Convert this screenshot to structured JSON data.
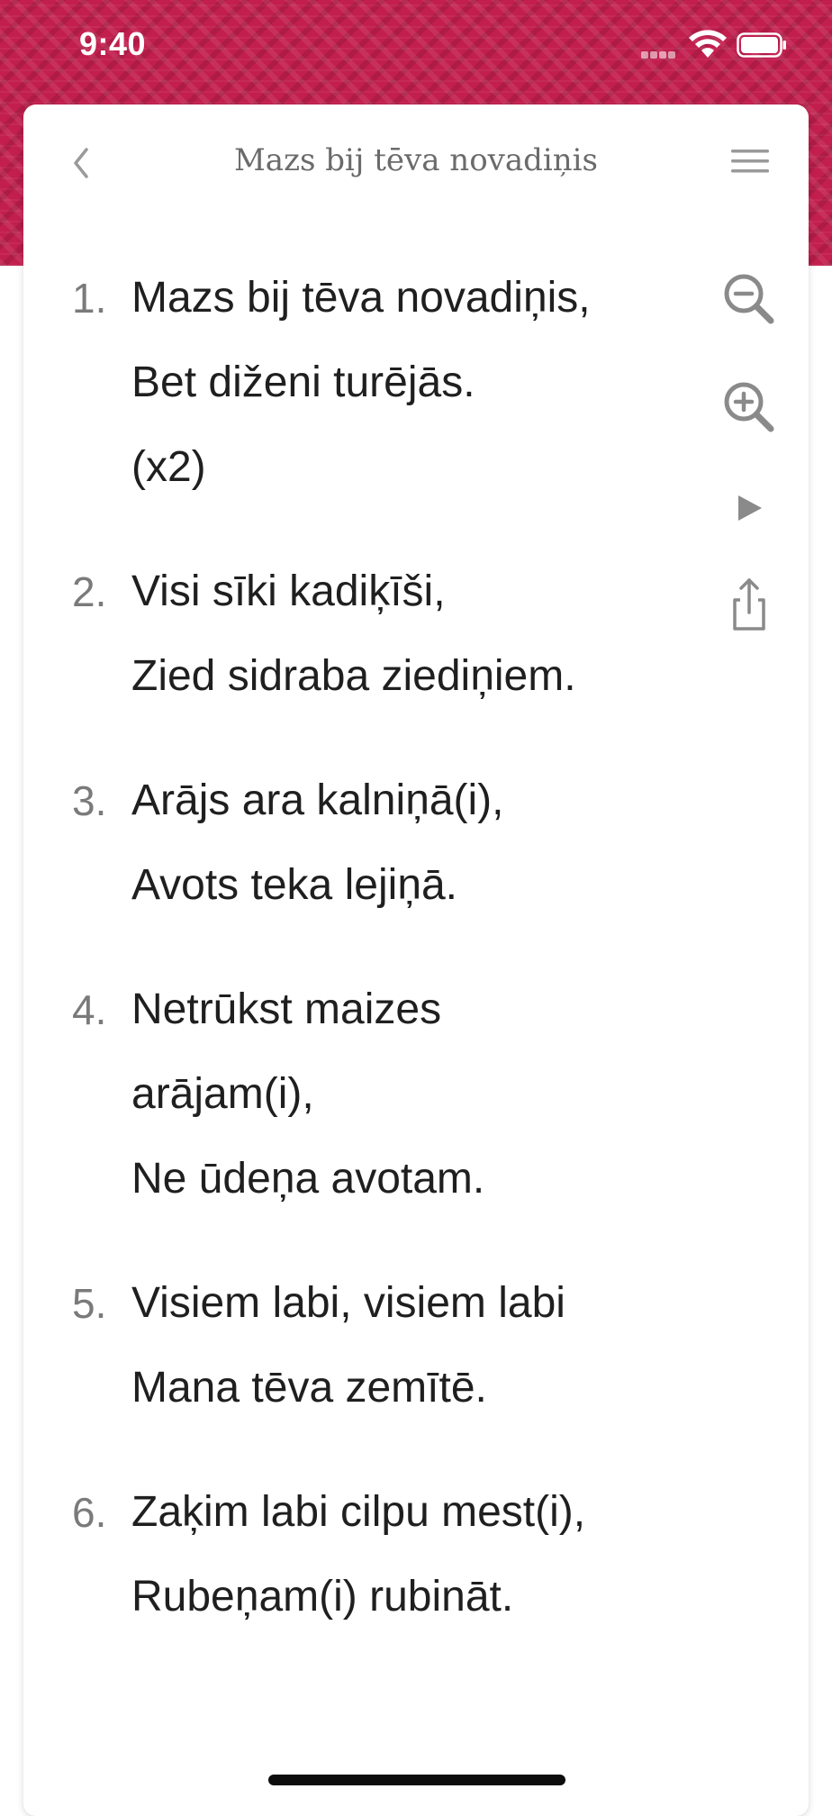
{
  "status_bar": {
    "time": "9:40"
  },
  "nav": {
    "title": "Mazs bij tēva novadiņis",
    "back_icon": "chevron-left-icon",
    "menu_icon": "hamburger-menu-icon"
  },
  "verses": [
    {
      "number": "1.",
      "lines": [
        "Mazs bij tēva novadiņis,",
        "Bet diženi turējās.",
        "(x2)"
      ]
    },
    {
      "number": "2.",
      "lines": [
        "Visi sīki kadiķīši,",
        "Zied sidraba ziediņiem."
      ]
    },
    {
      "number": "3.",
      "lines": [
        "Arājs ara kalniņā(i),",
        "Avots teka lejiņā."
      ]
    },
    {
      "number": "4.",
      "lines": [
        "Netrūkst maizes",
        "arājam(i),",
        "Ne ūdeņa avotam."
      ]
    },
    {
      "number": "5.",
      "lines": [
        "Visiem labi, visiem labi",
        "Mana tēva zemītē."
      ]
    },
    {
      "number": "6.",
      "lines": [
        "Zaķim labi cilpu mest(i),",
        "Rubeņam(i) rubināt."
      ]
    }
  ],
  "toolbar": {
    "zoom_out_icon": "zoom-out-icon",
    "zoom_in_icon": "zoom-in-icon",
    "play_icon": "play-icon",
    "share_icon": "share-icon"
  },
  "colors": {
    "header": "#c21f4e",
    "icon_gray": "#8a8a8a",
    "text": "#1f1f1f"
  }
}
